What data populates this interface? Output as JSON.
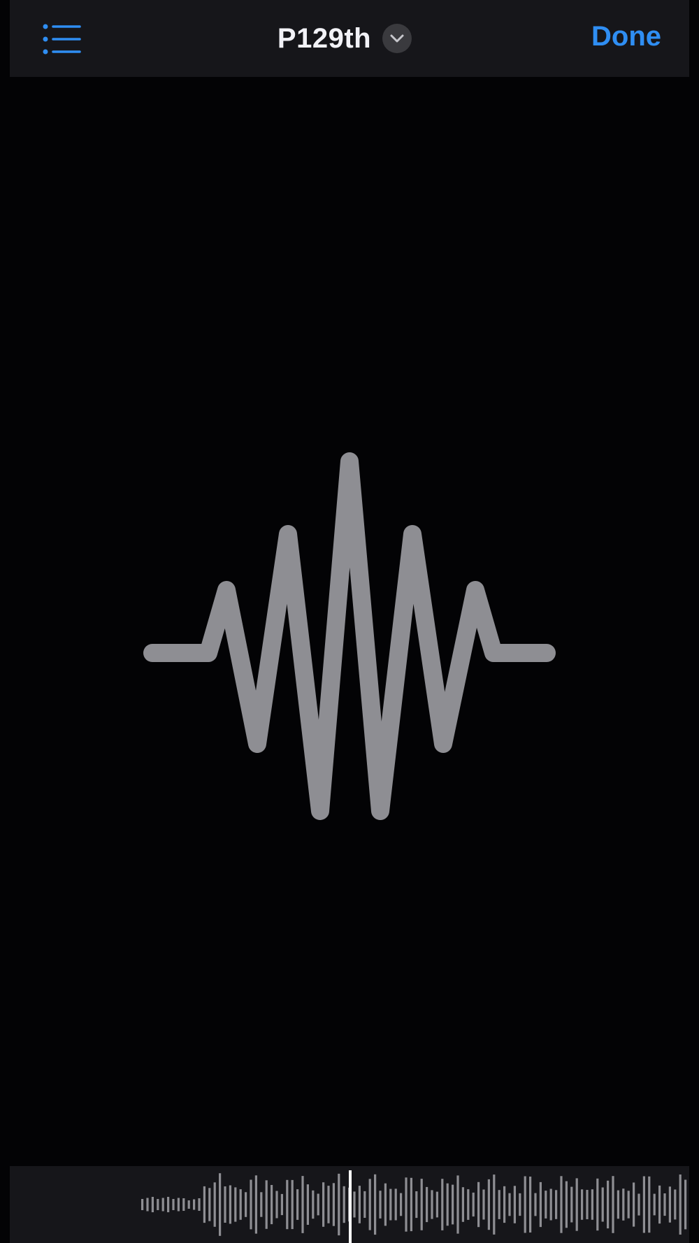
{
  "header": {
    "title": "P129th",
    "done_label": "Done"
  },
  "icons": {
    "list": "list-bullet-icon",
    "chevron": "chevron-down-icon",
    "waveform": "waveform-icon",
    "playhead": "playhead"
  },
  "colors": {
    "accent": "#2f8ef3",
    "waveform": "#8e8e93",
    "background": "#030305",
    "bar": "#16161a"
  }
}
